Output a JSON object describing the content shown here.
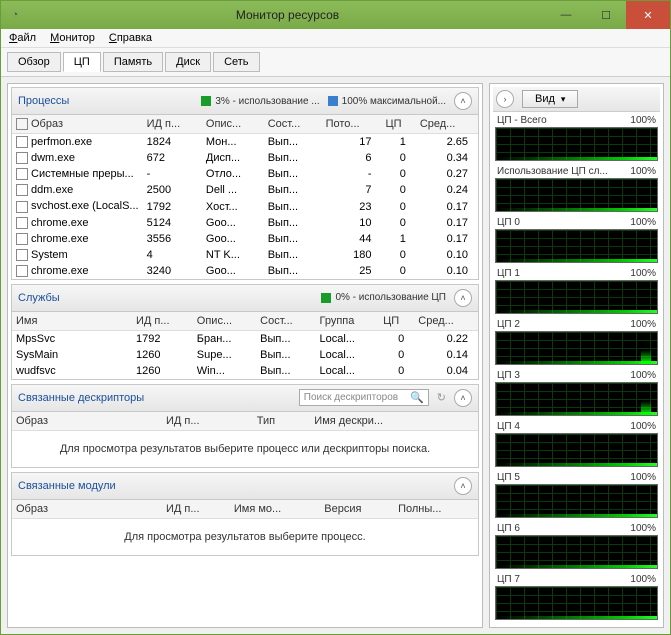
{
  "window": {
    "title": "Монитор ресурсов"
  },
  "menu": {
    "file": "Файл",
    "monitor": "Монитор",
    "help": "Справка"
  },
  "tabs": {
    "overview": "Обзор",
    "cpu": "ЦП",
    "memory": "Память",
    "disk": "Диск",
    "network": "Сеть"
  },
  "processes": {
    "title": "Процессы",
    "legend1": "3% - использование ...",
    "legend2": "100% максимальной...",
    "cols": {
      "image": "Образ",
      "pid": "ИД п...",
      "desc": "Опис...",
      "status": "Сост...",
      "threads": "Пото...",
      "cpu": "ЦП",
      "avg": "Сред..."
    },
    "rows": [
      {
        "image": "perfmon.exe",
        "pid": "1824",
        "desc": "Мон...",
        "status": "Вып...",
        "threads": "17",
        "cpu": "1",
        "avg": "2.65"
      },
      {
        "image": "dwm.exe",
        "pid": "672",
        "desc": "Дисп...",
        "status": "Вып...",
        "threads": "6",
        "cpu": "0",
        "avg": "0.34"
      },
      {
        "image": "Системные преры...",
        "pid": "-",
        "desc": "Отло...",
        "status": "Вып...",
        "threads": "-",
        "cpu": "0",
        "avg": "0.27"
      },
      {
        "image": "ddm.exe",
        "pid": "2500",
        "desc": "Dell ...",
        "status": "Вып...",
        "threads": "7",
        "cpu": "0",
        "avg": "0.24"
      },
      {
        "image": "svchost.exe (LocalS...",
        "pid": "1792",
        "desc": "Хост...",
        "status": "Вып...",
        "threads": "23",
        "cpu": "0",
        "avg": "0.17"
      },
      {
        "image": "chrome.exe",
        "pid": "5124",
        "desc": "Goo...",
        "status": "Вып...",
        "threads": "10",
        "cpu": "0",
        "avg": "0.17"
      },
      {
        "image": "chrome.exe",
        "pid": "3556",
        "desc": "Goo...",
        "status": "Вып...",
        "threads": "44",
        "cpu": "1",
        "avg": "0.17"
      },
      {
        "image": "System",
        "pid": "4",
        "desc": "NT K...",
        "status": "Вып...",
        "threads": "180",
        "cpu": "0",
        "avg": "0.10"
      },
      {
        "image": "chrome.exe",
        "pid": "3240",
        "desc": "Goo...",
        "status": "Вып...",
        "threads": "25",
        "cpu": "0",
        "avg": "0.10"
      }
    ]
  },
  "services": {
    "title": "Службы",
    "legend1": "0% - использование ЦП",
    "cols": {
      "name": "Имя",
      "pid": "ИД п...",
      "desc": "Опис...",
      "status": "Сост...",
      "group": "Группа",
      "cpu": "ЦП",
      "avg": "Сред..."
    },
    "rows": [
      {
        "name": "MpsSvc",
        "pid": "1792",
        "desc": "Бран...",
        "status": "Вып...",
        "group": "Local...",
        "cpu": "0",
        "avg": "0.22"
      },
      {
        "name": "SysMain",
        "pid": "1260",
        "desc": "Supe...",
        "status": "Вып...",
        "group": "Local...",
        "cpu": "0",
        "avg": "0.14"
      },
      {
        "name": "wudfsvc",
        "pid": "1260",
        "desc": "Win...",
        "status": "Вып...",
        "group": "Local...",
        "cpu": "0",
        "avg": "0.04"
      }
    ]
  },
  "handles": {
    "title": "Связанные дескрипторы",
    "search_placeholder": "Поиск дескрипторов",
    "cols": {
      "image": "Образ",
      "pid": "ИД п...",
      "type": "Тип",
      "name": "Имя дескри..."
    },
    "msg": "Для просмотра результатов выберите процесс или дескрипторы поиска."
  },
  "modules": {
    "title": "Связанные модули",
    "cols": {
      "image": "Образ",
      "pid": "ИД п...",
      "modname": "Имя мо...",
      "version": "Версия",
      "path": "Полны..."
    },
    "msg": "Для просмотра результатов выберите процесс."
  },
  "rightpane": {
    "view_label": "Вид",
    "graphs": [
      {
        "label": "ЦП - Всего",
        "pct": "100%"
      },
      {
        "label": "Использование ЦП сл...",
        "pct": "100%"
      },
      {
        "label": "ЦП 0",
        "pct": "100%"
      },
      {
        "label": "ЦП 1",
        "pct": "100%"
      },
      {
        "label": "ЦП 2",
        "pct": "100%"
      },
      {
        "label": "ЦП 3",
        "pct": "100%"
      },
      {
        "label": "ЦП 4",
        "pct": "100%"
      },
      {
        "label": "ЦП 5",
        "pct": "100%"
      },
      {
        "label": "ЦП 6",
        "pct": "100%"
      },
      {
        "label": "ЦП 7",
        "pct": "100%"
      }
    ]
  }
}
